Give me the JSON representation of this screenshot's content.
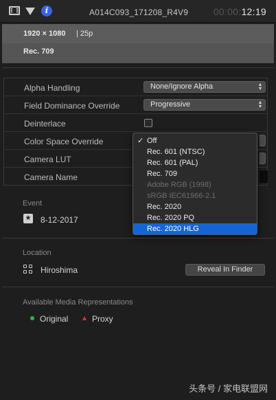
{
  "toolbar": {
    "clip_name": "A014C093_171208_R4V9",
    "timecode_dim": "00:00:",
    "timecode_bright": "12:19"
  },
  "specs": {
    "resolution": "1920 × 1080",
    "frame_rate": "| 25p",
    "color_space": "Rec. 709"
  },
  "settings": [
    {
      "label": "Alpha Handling",
      "value": "None/Ignore Alpha"
    },
    {
      "label": "Field Dominance Override",
      "value": "Progressive"
    },
    {
      "label": "Deinterlace"
    },
    {
      "label": "Color Space Override"
    },
    {
      "label": "Camera LUT"
    },
    {
      "label": "Camera Name"
    }
  ],
  "color_space_menu": {
    "items": [
      {
        "label": "Off",
        "checked": true,
        "enabled": true
      },
      {
        "label": "Rec. 601 (NTSC)",
        "enabled": true
      },
      {
        "label": "Rec. 601 (PAL)",
        "enabled": true
      },
      {
        "label": "Rec. 709",
        "enabled": true
      },
      {
        "label": "Adobe RGB (1998)",
        "enabled": false
      },
      {
        "label": "sRGB IEC61966-2.1",
        "enabled": false
      },
      {
        "label": "Rec. 2020",
        "enabled": true
      },
      {
        "label": "Rec. 2020 PQ",
        "enabled": true
      },
      {
        "label": "Rec. 2020 HLG",
        "enabled": true,
        "highlighted": true
      }
    ],
    "check_mark": "✓"
  },
  "event": {
    "heading": "Event",
    "date": "8-12-2017",
    "icon": "star-icon"
  },
  "location": {
    "heading": "Location",
    "name": "Hiroshima",
    "reveal_button": "Reveal In Finder",
    "icon": "grid-icon"
  },
  "media": {
    "heading": "Available Media Representations",
    "options": [
      "Original",
      "Proxy"
    ],
    "colors": {
      "original": "#3fae4a",
      "proxy": "#e03131"
    }
  },
  "watermark": {
    "prefix": "头条号 / 家电联盟网",
    "brand": "家电联盟"
  }
}
